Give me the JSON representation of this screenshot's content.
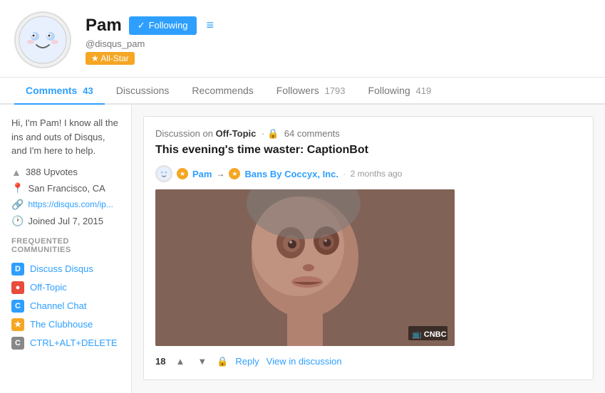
{
  "profile": {
    "name": "Pam",
    "handle": "@disqus_pam",
    "badge": "★ All-Star",
    "avatar_emoji": "😊",
    "following_label": "Following",
    "menu_label": "≡",
    "bio": "Hi, I'm Pam! I know all the ins and outs of Disqus, and I'm here to help.",
    "upvotes": "388 Upvotes",
    "location": "San Francisco, CA",
    "link": "https://disqus.com/ip...",
    "joined": "Joined Jul 7, 2015"
  },
  "tabs": [
    {
      "label": "Comments",
      "count": "43",
      "active": true
    },
    {
      "label": "Discussions",
      "count": "",
      "active": false
    },
    {
      "label": "Recommends",
      "count": "",
      "active": false
    },
    {
      "label": "Followers",
      "count": "1793",
      "active": false
    },
    {
      "label": "Following",
      "count": "419",
      "active": false
    }
  ],
  "communities_title": "Frequented Communities",
  "communities": [
    {
      "name": "Discuss Disqus",
      "icon": "D",
      "color": "icon-blue"
    },
    {
      "name": "Off-Topic",
      "icon": "●",
      "color": "icon-red"
    },
    {
      "name": "Channel Chat",
      "icon": "C",
      "color": "icon-blue"
    },
    {
      "name": "The Clubhouse",
      "icon": "★",
      "color": "icon-yellow"
    },
    {
      "name": "CTRL+ALT+DELETE",
      "icon": "C",
      "color": "icon-gray"
    }
  ],
  "post": {
    "discussion_label": "Discussion on",
    "channel": "Off-Topic",
    "lock_icon": "🔒",
    "comment_count": "64 comments",
    "title": "This evening's time waster: CaptionBot",
    "author": "Pam",
    "arrow": "→",
    "recipient": "Bans By Coccyx, Inc.",
    "time": "2 months ago",
    "vote_count": "18",
    "cnbc_label": "🎬 CNBC",
    "reply_label": "Reply",
    "view_label": "View in discussion"
  }
}
